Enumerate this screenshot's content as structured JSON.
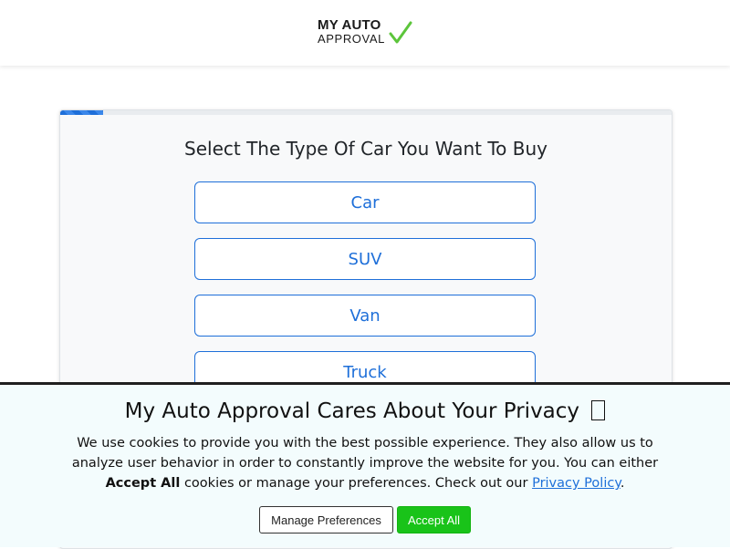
{
  "header": {
    "logo_line1": "MY AUTO",
    "logo_line2": "APPROVAL",
    "logo_check_color": "#5cc53b"
  },
  "form": {
    "progress_percent": 7,
    "question": "Select The Type Of Car You Want To Buy",
    "options": [
      "Car",
      "SUV",
      "Van",
      "Truck"
    ]
  },
  "cookie_banner": {
    "title": "My Auto Approval Cares About Your Privacy",
    "title_icon": "cookie-icon",
    "text_part1": "We use cookies to provide you with the best possible experience. They also allow us to analyze user behavior in order to constantly improve the website for you. You can either ",
    "text_bold": "Accept All",
    "text_part2": " cookies or manage your preferences. Check out our ",
    "link_text": "Privacy Policy",
    "text_end": ".",
    "manage_label": "Manage Preferences",
    "accept_label": "Accept All"
  },
  "colors": {
    "accent": "#1e6fd9",
    "accept_button": "#19c319",
    "banner_bg": "#f3fcfd"
  }
}
